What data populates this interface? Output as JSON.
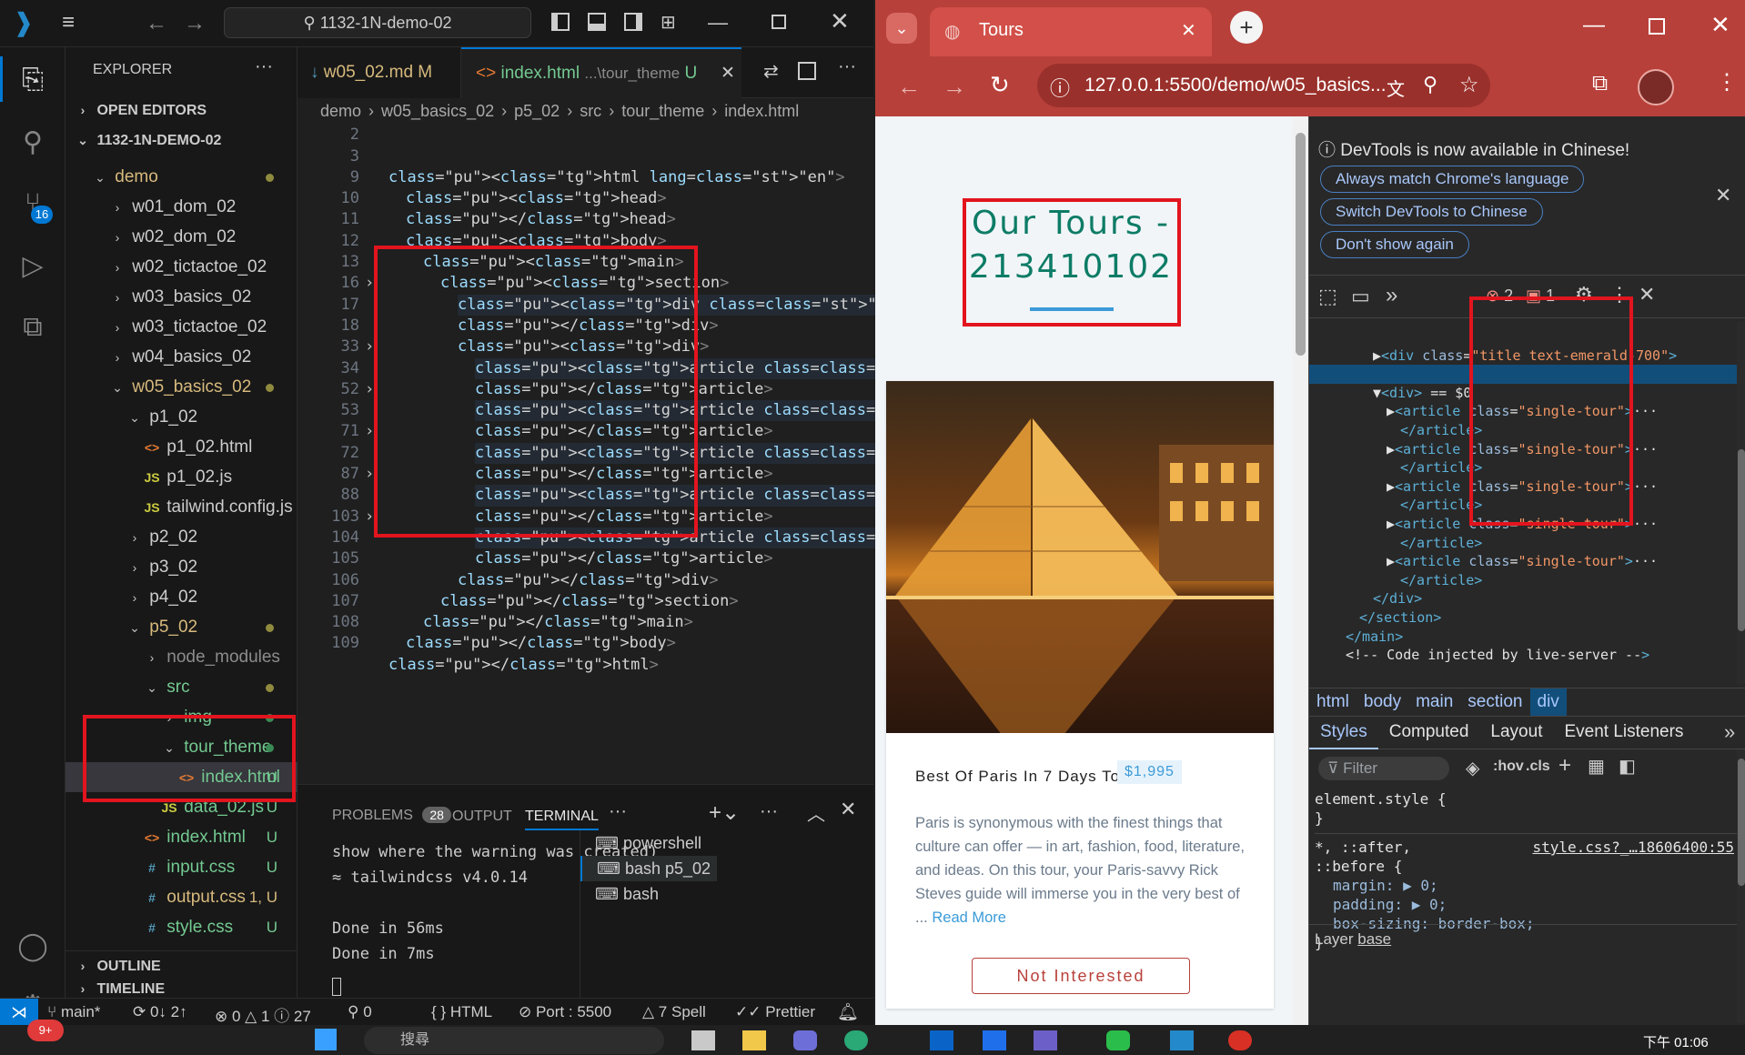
{
  "vscode": {
    "search_box": "1132-1N-demo-02",
    "explorer_title": "EXPLORER",
    "open_editors": "OPEN EDITORS",
    "workspace": "1132-1N-DEMO-02",
    "badge_source_control": "16",
    "tree": [
      {
        "label": "demo",
        "indent": 1,
        "chev": "v",
        "color": "#d7ba7d",
        "dot": "y"
      },
      {
        "label": "w01_dom_02",
        "indent": 2,
        "chev": ">",
        "color": "#cccccc"
      },
      {
        "label": "w02_dom_02",
        "indent": 2,
        "chev": ">",
        "color": "#cccccc"
      },
      {
        "label": "w02_tictactoe_02",
        "indent": 2,
        "chev": ">",
        "color": "#cccccc"
      },
      {
        "label": "w03_basics_02",
        "indent": 2,
        "chev": ">",
        "color": "#cccccc"
      },
      {
        "label": "w03_tictactoe_02",
        "indent": 2,
        "chev": ">",
        "color": "#cccccc"
      },
      {
        "label": "w04_basics_02",
        "indent": 2,
        "chev": ">",
        "color": "#cccccc"
      },
      {
        "label": "w05_basics_02",
        "indent": 2,
        "chev": "v",
        "color": "#d7ba7d",
        "dot": "y"
      },
      {
        "label": "p1_02",
        "indent": 3,
        "chev": "v",
        "color": "#cccccc"
      },
      {
        "label": "p1_02.html",
        "indent": 4,
        "icon": "<>",
        "iconColor": "#e37933",
        "color": "#cccccc"
      },
      {
        "label": "p1_02.js",
        "indent": 4,
        "icon": "JS",
        "iconColor": "#cbcb41",
        "color": "#cccccc"
      },
      {
        "label": "tailwind.config.js",
        "indent": 4,
        "icon": "JS",
        "iconColor": "#cbcb41",
        "color": "#cccccc"
      },
      {
        "label": "p2_02",
        "indent": 3,
        "chev": ">",
        "color": "#cccccc"
      },
      {
        "label": "p3_02",
        "indent": 3,
        "chev": ">",
        "color": "#cccccc"
      },
      {
        "label": "p4_02",
        "indent": 3,
        "chev": ">",
        "color": "#cccccc"
      },
      {
        "label": "p5_02",
        "indent": 3,
        "chev": "v",
        "color": "#d7ba7d",
        "dot": "y"
      },
      {
        "label": "node_modules",
        "indent": 4,
        "chev": ">",
        "color": "#8c8c8c"
      },
      {
        "label": "src",
        "indent": 4,
        "chev": "v",
        "color": "#73c991",
        "dot": "y"
      },
      {
        "label": "img",
        "indent": 5,
        "chev": ">",
        "color": "#73c991",
        "dot": "g"
      },
      {
        "label": "tour_theme",
        "indent": 5,
        "chev": "v",
        "color": "#73c991",
        "dot": "g"
      },
      {
        "label": "index.html",
        "indent": 6,
        "icon": "<>",
        "iconColor": "#e37933",
        "color": "#73c991",
        "status": "U",
        "selected": true
      },
      {
        "label": "data_02.js",
        "indent": 5,
        "icon": "JS",
        "iconColor": "#cbcb41",
        "color": "#73c991",
        "status": "U"
      },
      {
        "label": "index.html",
        "indent": 4,
        "icon": "<>",
        "iconColor": "#e37933",
        "color": "#73c991",
        "status": "U"
      },
      {
        "label": "input.css",
        "indent": 4,
        "icon": "#",
        "iconColor": "#519aba",
        "color": "#73c991",
        "status": "U"
      },
      {
        "label": "output.css",
        "indent": 4,
        "icon": "#",
        "iconColor": "#519aba",
        "color": "#d7ba7d",
        "status": "1, U"
      },
      {
        "label": "style.css",
        "indent": 4,
        "icon": "#",
        "iconColor": "#519aba",
        "color": "#73c991",
        "status": "U"
      }
    ],
    "outline": "OUTLINE",
    "timeline": "TIMELINE",
    "tab1": {
      "label": "w05_02.md",
      "status": "M"
    },
    "tab2": {
      "label": "index.html",
      "path": "...\\tour_theme",
      "status": "U"
    },
    "breadcrumb": [
      "demo",
      "w05_basics_02",
      "p5_02",
      "src",
      "tour_theme",
      "index.html"
    ],
    "code": [
      {
        "n": "2",
        "t": "<html lang=\"en\">",
        "indent": 0
      },
      {
        "n": "3",
        "t": "<head>",
        "indent": 1
      },
      {
        "n": "9",
        "t": "</head>",
        "indent": 1
      },
      {
        "n": "10",
        "t": "<body>",
        "indent": 1
      },
      {
        "n": "11",
        "t": "<main>",
        "indent": 2
      },
      {
        "n": "12",
        "t": "<section>",
        "indent": 3
      },
      {
        "n": "13",
        "t": "<div class=\"title\">···",
        "indent": 4,
        "fold": true
      },
      {
        "n": "16",
        "t": "</div>",
        "indent": 4
      },
      {
        "n": "17",
        "t": "<div>",
        "indent": 4
      },
      {
        "n": "18",
        "t": "<article class=\"single-tour\">···",
        "indent": 5,
        "fold": true
      },
      {
        "n": "33",
        "t": "</article>",
        "indent": 5
      },
      {
        "n": "34",
        "t": "<article class=\"single-tour\">···",
        "indent": 5,
        "fold": true
      },
      {
        "n": "52",
        "t": "</article>",
        "indent": 5
      },
      {
        "n": "53",
        "t": "<article class=\"single-tour\">···",
        "indent": 5,
        "fold": true
      },
      {
        "n": "71",
        "t": "</article>",
        "indent": 5
      },
      {
        "n": "72",
        "t": "<article class=\"single-tour\">···",
        "indent": 5,
        "fold": true
      },
      {
        "n": "87",
        "t": "</article>",
        "indent": 5
      },
      {
        "n": "88",
        "t": "<article class=\"single-tour\">···",
        "indent": 5,
        "fold": true
      },
      {
        "n": "103",
        "t": "</article>",
        "indent": 5
      },
      {
        "n": "104",
        "t": "</div>",
        "indent": 4
      },
      {
        "n": "105",
        "t": "</section>",
        "indent": 3
      },
      {
        "n": "106",
        "t": "</main>",
        "indent": 2
      },
      {
        "n": "107",
        "t": "</body>",
        "indent": 1
      },
      {
        "n": "108",
        "t": "</html>",
        "indent": 0
      },
      {
        "n": "109",
        "t": "",
        "indent": 0
      }
    ],
    "panel_tabs": {
      "problems": "PROBLEMS",
      "problems_count": "28",
      "output": "OUTPUT",
      "terminal": "TERMINAL"
    },
    "terminal_lines": [
      "show where the warning was created)",
      "≈ tailwindcss v4.0.14",
      "",
      "Done in 56ms",
      "Done in 7ms"
    ],
    "terminals": [
      "powershell",
      "bash  p5_02",
      "bash"
    ],
    "status": {
      "branch": "main*",
      "sync": "0↓ 2↑",
      "errors": "0",
      "warnings": "1",
      "info": "27",
      "ports": "0",
      "lang": "HTML",
      "port": "Port : 5500",
      "spell": "7 Spell",
      "prettier": "Prettier"
    }
  },
  "chrome": {
    "tab_title": "Tours",
    "url": "127.0.0.1:5500/demo/w05_basics...",
    "page": {
      "heading": "Our Tours - 213410102",
      "tour_name": "Best Of Paris In 7 Days Tour",
      "price": "$1,995",
      "description": "Paris is synonymous with the finest things that culture can offer — in art, fashion, food, literature, and ideas. On this tour, your Paris-savvy Rick Steves guide will immerse you in the very best of ...",
      "read_more": "Read More",
      "button": "Not Interested"
    },
    "devtools": {
      "notice": "DevTools is now available in Chinese!",
      "btn1": "Always match Chrome's language",
      "btn2": "Switch DevTools to Chinese",
      "btn3": "Don't show again",
      "errors": "2",
      "issues": "1",
      "dom": [
        {
          "t": "▶<div class=\"title text-emerald-700\">",
          "indent": 4
        },
        {
          "t": "··· </div>",
          "indent": 5
        },
        {
          "t": "▼<div> == $0",
          "indent": 4,
          "sel": true
        },
        {
          "t": "▶<article class=\"single-tour\">···",
          "indent": 5
        },
        {
          "t": "</article>",
          "indent": 6
        },
        {
          "t": "▶<article class=\"single-tour\">···",
          "indent": 5
        },
        {
          "t": "</article>",
          "indent": 6
        },
        {
          "t": "▶<article class=\"single-tour\">···",
          "indent": 5
        },
        {
          "t": "</article>",
          "indent": 6
        },
        {
          "t": "▶<article class=\"single-tour\">···",
          "indent": 5
        },
        {
          "t": "</article>",
          "indent": 6
        },
        {
          "t": "▶<article class=\"single-tour\">···",
          "indent": 5
        },
        {
          "t": "</article>",
          "indent": 6
        },
        {
          "t": "</div>",
          "indent": 4
        },
        {
          "t": "</section>",
          "indent": 3
        },
        {
          "t": "</main>",
          "indent": 2
        },
        {
          "t": "<!-- Code injected by live-server -->",
          "indent": 2
        }
      ],
      "crumbs": [
        "html",
        "body",
        "main",
        "section",
        "div"
      ],
      "style_tabs": [
        "Styles",
        "Computed",
        "Layout",
        "Event Listeners"
      ],
      "filter": "Filter",
      "hov": ":hov",
      "cls": ".cls",
      "element_style": "element.style {",
      "close_brace": "}",
      "rule_selector": "*, ::after,",
      "rule_selector2": "::before {",
      "rule_source": "style.css?_…18606400:55",
      "props": [
        "margin: ▶ 0;",
        "padding: ▶ 0;",
        "box-sizing: border-box;"
      ],
      "layer": "Layer",
      "layer_link": "base"
    }
  },
  "taskbar": {
    "badge": "9+",
    "search": "搜尋",
    "time": "下午 01:06"
  }
}
